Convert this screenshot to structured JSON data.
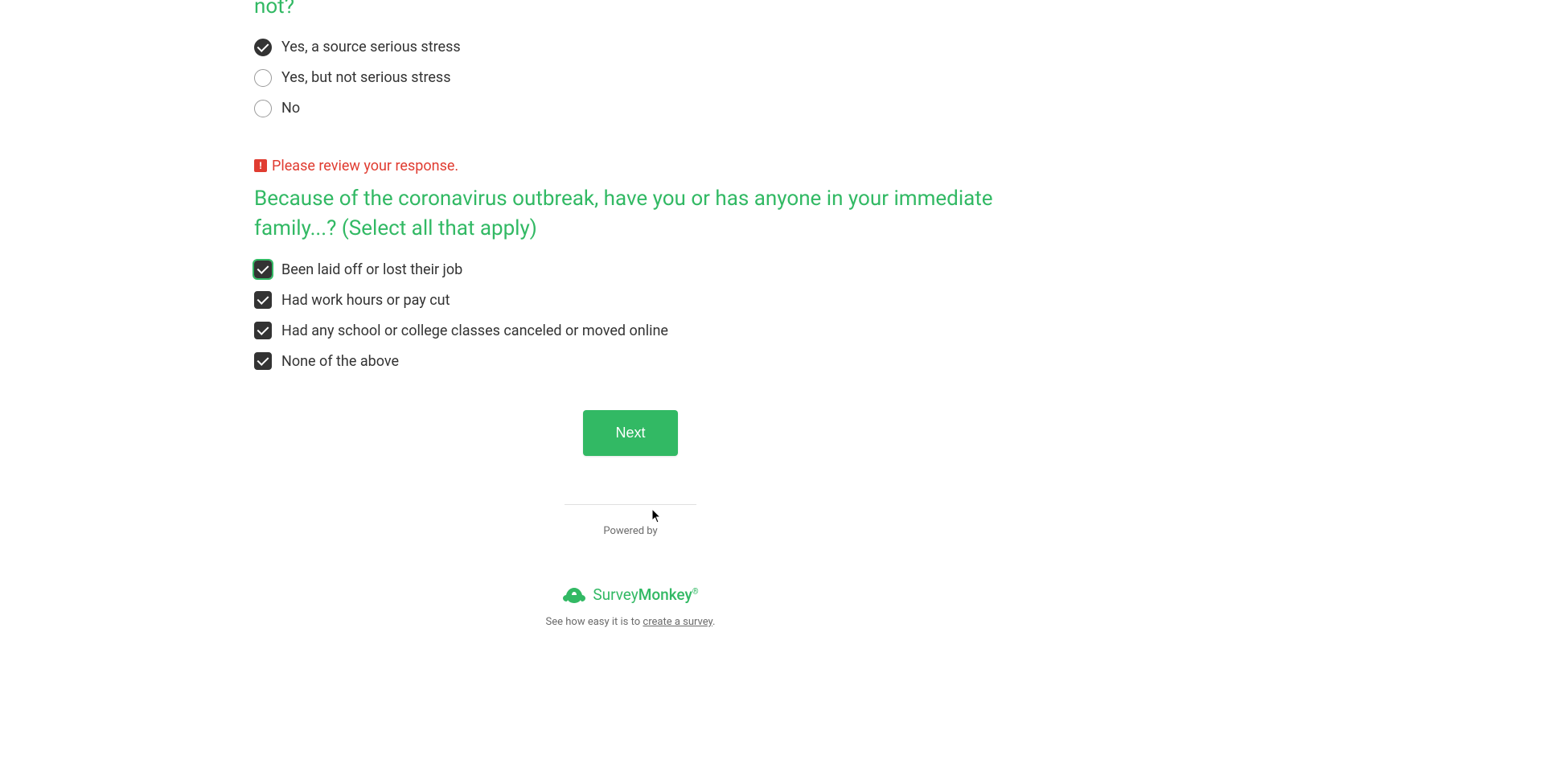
{
  "question1": {
    "title_partial": "not?",
    "options": [
      {
        "label": "Yes, a source serious stress",
        "selected": true
      },
      {
        "label": "Yes, but not serious stress",
        "selected": false
      },
      {
        "label": "No",
        "selected": false
      }
    ]
  },
  "error": {
    "message": "Please review your response."
  },
  "question2": {
    "title": "Because of the coronavirus outbreak, have you or has anyone in your immediate family...? (Select all that apply)",
    "options": [
      {
        "label": "Been laid off or lost their job",
        "checked": true,
        "focused": true
      },
      {
        "label": "Had work hours or pay cut",
        "checked": true,
        "focused": false
      },
      {
        "label": "Had any school or college classes canceled or moved online",
        "checked": true,
        "focused": false
      },
      {
        "label": "None of the above",
        "checked": true,
        "focused": false
      }
    ]
  },
  "buttons": {
    "next": "Next"
  },
  "footer": {
    "powered_by": "Powered by",
    "brand_first": "Survey",
    "brand_second": "Monkey",
    "see_text": "See how easy it is to ",
    "link_text": "create a survey",
    "period": "."
  }
}
